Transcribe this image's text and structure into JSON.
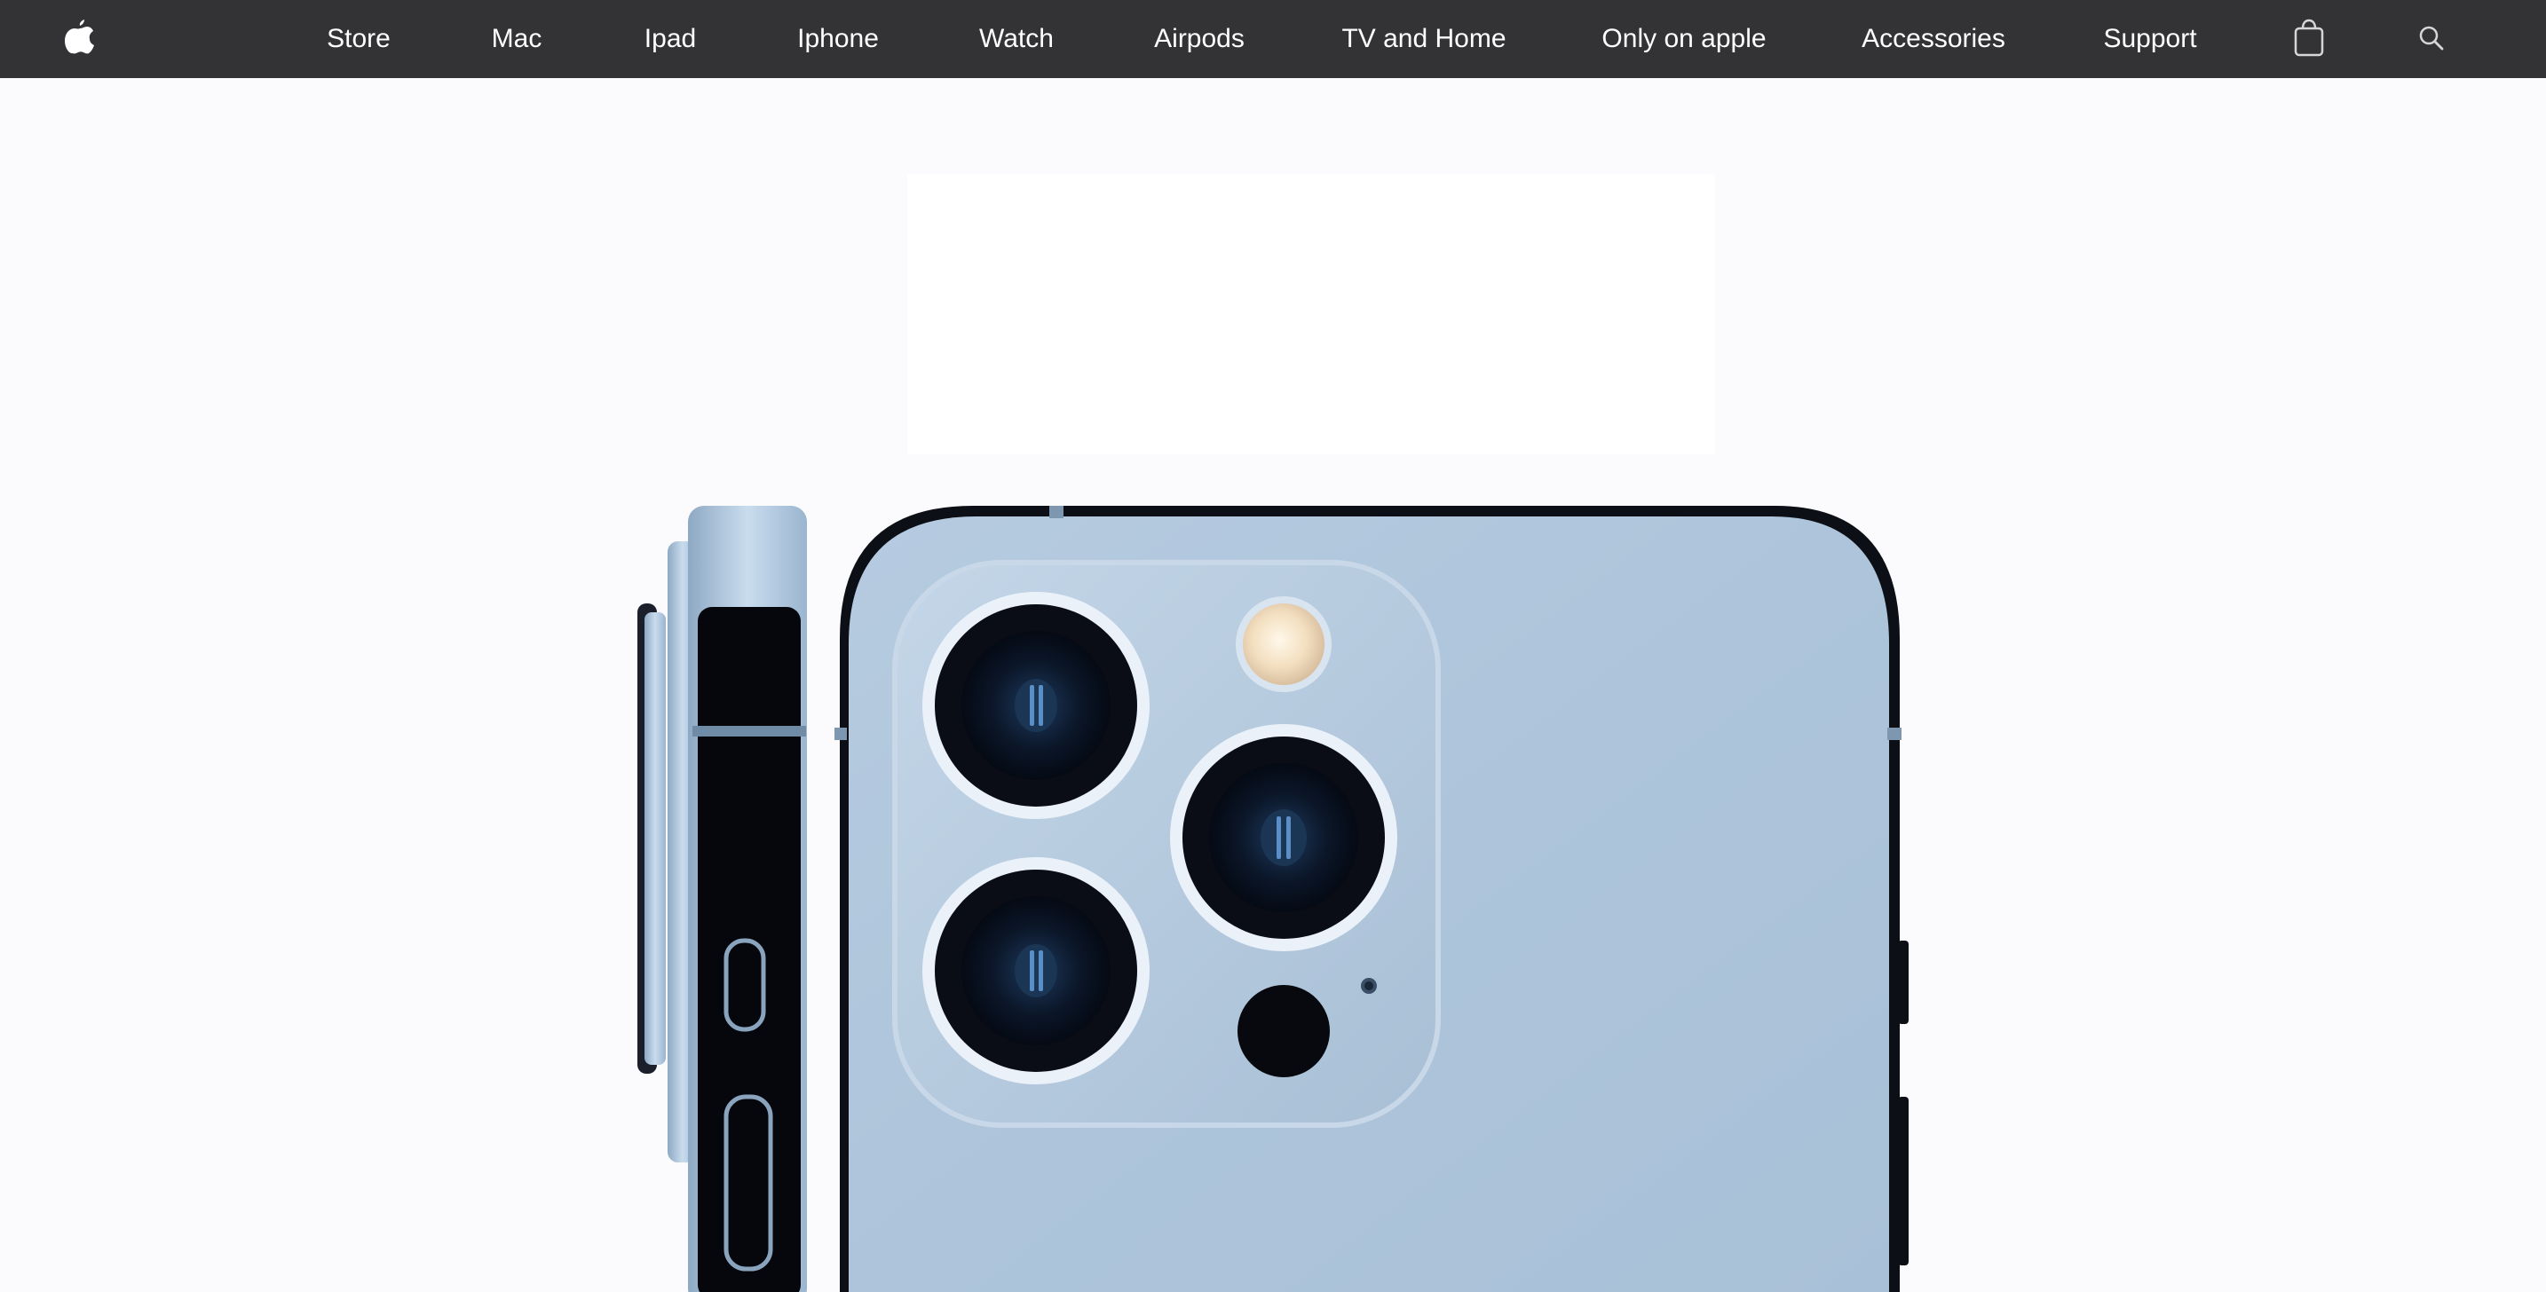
{
  "nav": {
    "items": [
      {
        "label": "Store"
      },
      {
        "label": "Mac"
      },
      {
        "label": "Ipad"
      },
      {
        "label": "Iphone"
      },
      {
        "label": "Watch"
      },
      {
        "label": "Airpods"
      },
      {
        "label": "TV and Home"
      },
      {
        "label": "Only on apple"
      },
      {
        "label": "Accessories"
      },
      {
        "label": "Support"
      }
    ],
    "logo_icon": "apple-logo-icon",
    "bag_icon": "shopping-bag-icon",
    "search_icon": "search-icon"
  },
  "hero": {
    "product_color": "#adc4da",
    "image": "iphone-pro-sierra-blue-camera"
  },
  "colors": {
    "nav_bg": "#333336",
    "page_bg": "#fbfbfd"
  }
}
